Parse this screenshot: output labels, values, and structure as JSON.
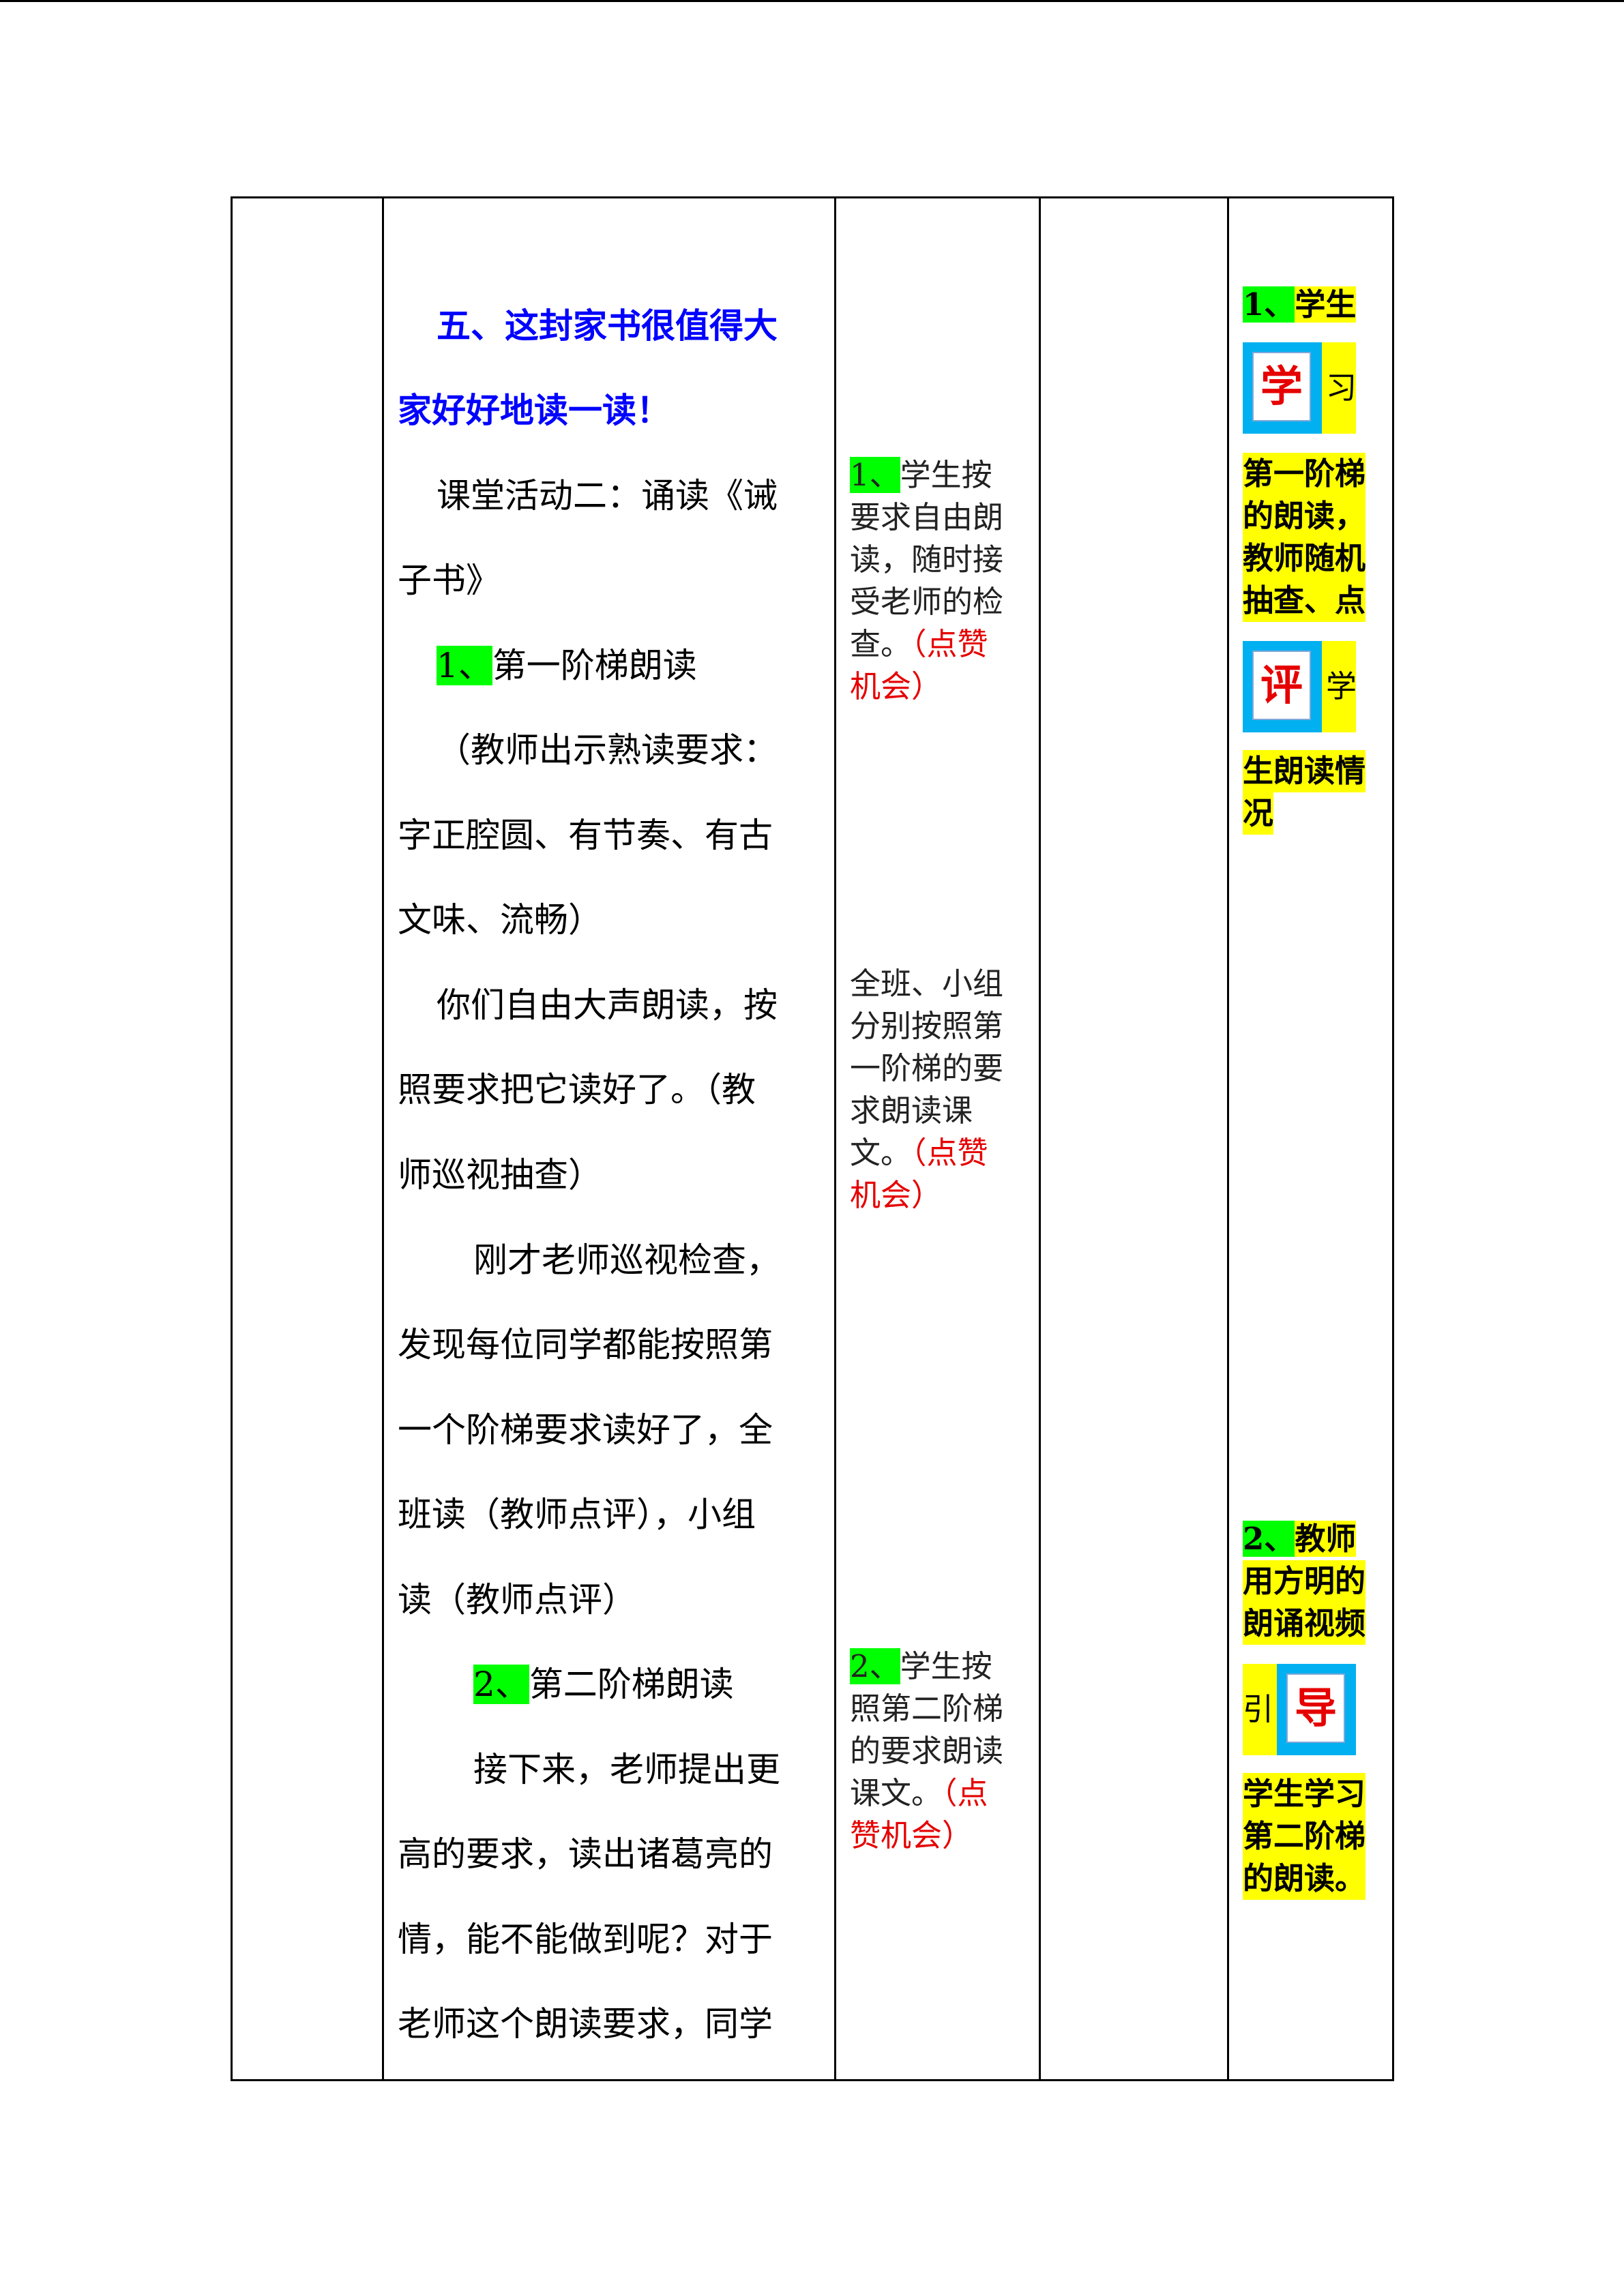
{
  "col2": {
    "lines": [
      "五、这封家书很值得大",
      "家好好地读一读！",
      "课堂活动二：诵读《诫",
      "子书》",
      "1、",
      "第一阶梯朗读",
      "（教师出示熟读要求：",
      "字正腔圆、有节奏、有古",
      "文味、流畅）",
      "你们自由大声朗读，按",
      "照要求把它读好了。（教",
      "师巡视抽查）",
      "刚才老师巡视检查，",
      "发现每位同学都能按照第",
      "一个阶梯要求读好了，全",
      "班读（教师点评），小组",
      "读（教师点评）",
      "2、",
      "第二阶梯朗读",
      "接下来，老师提出更",
      "高的要求，读出诸葛亮的",
      "情，能不能做到呢？对于",
      "老师这个朗读要求，同学"
    ]
  },
  "col3": {
    "b1": [
      "1、",
      "学生按",
      "要求自由朗",
      "读，随时接",
      "受老师的检",
      "查。",
      "（点赞",
      "机会）"
    ],
    "b2": [
      "全班、小组",
      "分别按照第",
      "一阶梯的要",
      "求朗读课",
      "文。",
      "（点赞",
      "机会）"
    ],
    "b3": [
      "2、",
      "学生按",
      "照第二阶梯",
      "的要求朗读",
      "课文。",
      "（点",
      "赞机会）"
    ]
  },
  "col5": {
    "a": [
      "1、",
      "学生"
    ],
    "badge1": {
      "char": "学",
      "tail": "习"
    },
    "b": [
      "第一阶梯",
      "的朗读，",
      "教师随机",
      "抽查、点"
    ],
    "badge2": {
      "char": "评",
      "tail": "学"
    },
    "c": [
      "生朗读情",
      "况"
    ],
    "d": [
      "2、",
      "教师",
      "用方明的",
      "朗诵视频"
    ],
    "badge3": {
      "lead": "引",
      "char": "导"
    },
    "e": [
      "学生学习",
      "第二阶梯",
      "的朗读。"
    ]
  },
  "colors": {
    "green_highlight": "#00ff00",
    "yellow_highlight": "#ffff00",
    "badge_blue": "#00b0f0",
    "emphasis_red": "#e60000",
    "title_blue": "#0000ff"
  }
}
